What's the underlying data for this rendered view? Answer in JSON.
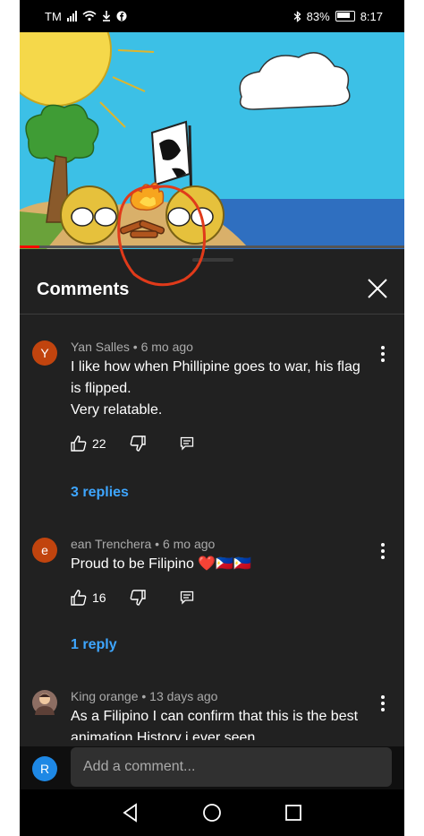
{
  "status": {
    "carrier": "TM",
    "battery": "83%",
    "time": "8:17",
    "icons": [
      "signal-icon",
      "wifi-icon",
      "download-icon",
      "facebook-icon",
      "bluetooth-icon",
      "battery-icon"
    ]
  },
  "video": {
    "progress_fraction": 0.05,
    "accent": "#ff0000"
  },
  "comments_panel": {
    "title": "Comments",
    "close_icon": "close-icon",
    "comments": [
      {
        "avatar_letter": "Y",
        "avatar_color": "#c1440e",
        "author": "Yan Salles",
        "time": "6 mo ago",
        "meta": "Yan Salles • 6 mo ago",
        "text": "I like how when Phillipine goes to war, his flag\nis flipped.\nVery relatable.",
        "likes": "22",
        "replies": "3 replies"
      },
      {
        "avatar_letter": "e",
        "avatar_color": "#c1440e",
        "author": "ean Trenchera",
        "time": "6 mo ago",
        "meta": "ean Trenchera • 6 mo ago",
        "text": "Proud to be Filipino ❤️🇵🇭🇵🇭",
        "likes": "16",
        "replies": "1 reply"
      },
      {
        "avatar_letter": "",
        "avatar_color": "#8d6e63",
        "author": "King orange",
        "time": "13 days ago",
        "meta": "King orange • 13 days ago",
        "text": "As a Filipino I can confirm that this is the best\nanimation History i ever seen"
      }
    ]
  },
  "add_comment": {
    "avatar_letter": "R",
    "placeholder": "Add a comment..."
  },
  "navbar": {
    "icons": [
      "back-icon",
      "home-icon",
      "recents-icon"
    ]
  }
}
